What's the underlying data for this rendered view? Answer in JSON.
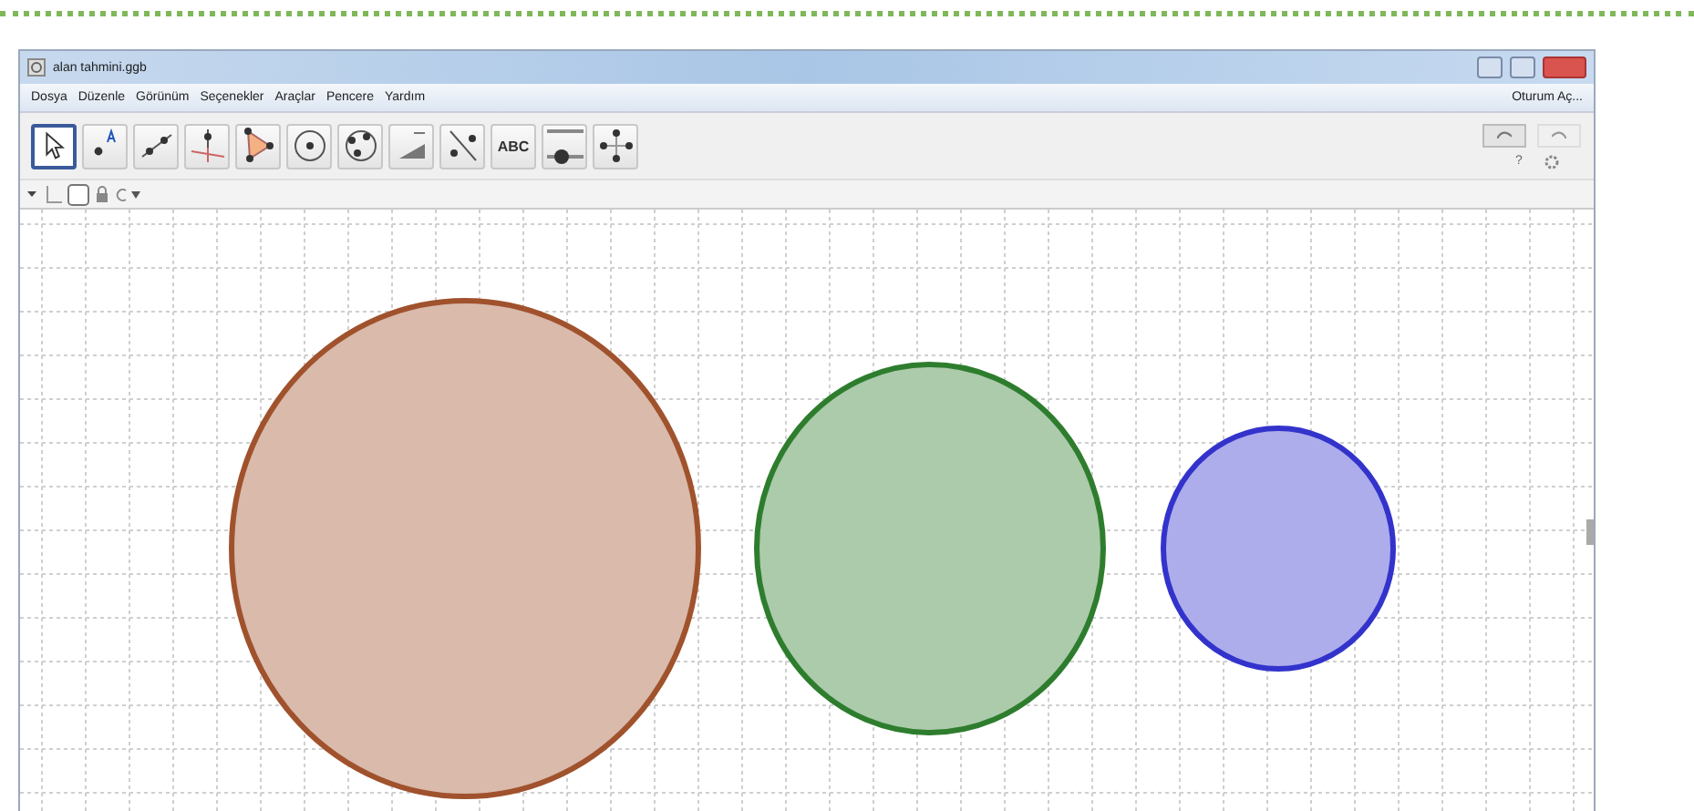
{
  "window": {
    "title": "alan tahmini.ggb"
  },
  "menu": [
    "Dosya",
    "Düzenle",
    "Görünüm",
    "Seçenekler",
    "Araçlar",
    "Pencere",
    "Yardım"
  ],
  "sign_in": "Oturum Aç...",
  "tools": [
    {
      "kind": "move",
      "selected": true
    },
    {
      "kind": "point",
      "selected": false
    },
    {
      "kind": "line",
      "selected": false
    },
    {
      "kind": "perpendicular",
      "selected": false
    },
    {
      "kind": "polygon",
      "selected": false
    },
    {
      "kind": "circle",
      "selected": false
    },
    {
      "kind": "conic",
      "selected": false
    },
    {
      "kind": "measure",
      "selected": false
    },
    {
      "kind": "reflect",
      "selected": false
    },
    {
      "kind": "text",
      "label": "ABC",
      "selected": false
    },
    {
      "kind": "slider",
      "selected": false
    },
    {
      "kind": "pan",
      "selected": false
    }
  ],
  "help": "?",
  "circles": [
    {
      "color": "#a0522d"
    },
    {
      "color": "#2e7d2e"
    },
    {
      "color": "#3333cc"
    }
  ]
}
